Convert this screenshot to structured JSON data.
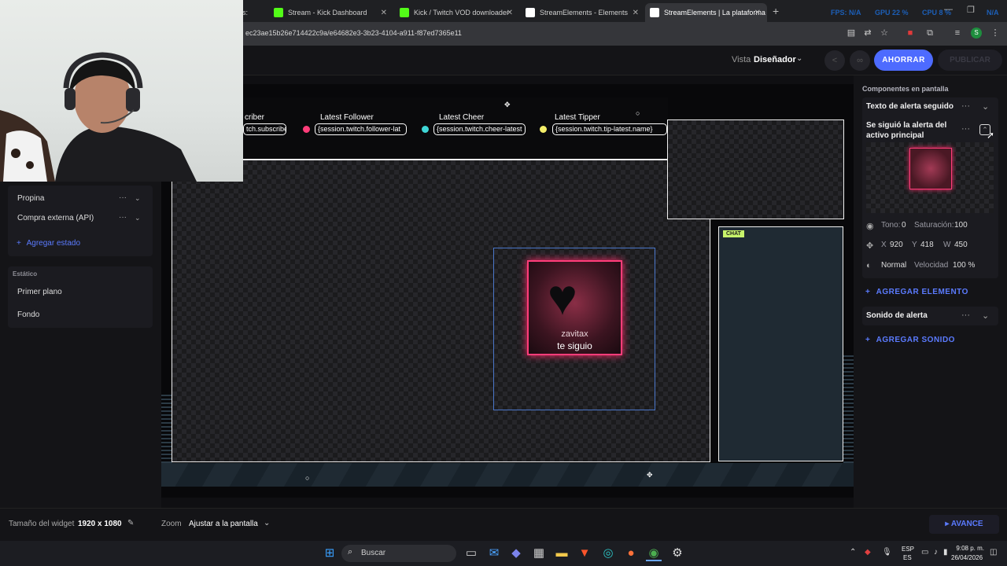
{
  "browser": {
    "tabs": [
      {
        "label": "s:",
        "fav": "#ffffff"
      },
      {
        "label": "Stream - Kick Dashboard",
        "fav": "#53fc18"
      },
      {
        "label": "Kick / Twitch VOD downloader",
        "fav": "#53fc18"
      },
      {
        "label": "StreamElements - Elements",
        "fav": "#ffffff"
      },
      {
        "label": "StreamElements | La plataforma",
        "fav": "#ffffff"
      }
    ],
    "url": "ec23ae15b26e714422c9a/e64682e3-3b23-4104-a911-f87ed7365e11",
    "perf": {
      "fps": "FPS: N/A",
      "gpu": "GPU 22 %",
      "cpu": "CPU 8 %",
      "na": "N/A"
    }
  },
  "toolbar": {
    "view_label": "Vista",
    "view_value": "Diseñador",
    "save_label": "AHORRAR",
    "publish_label": "PUBLICAR"
  },
  "left_panel": {
    "items": [
      {
        "label": "Propina"
      },
      {
        "label": "Compra externa (API)"
      }
    ],
    "add_state": "Agregar estado",
    "static_title": "Estático",
    "static_items": [
      {
        "label": "Primer plano"
      },
      {
        "label": "Fondo"
      }
    ]
  },
  "canvas": {
    "labels": [
      {
        "title": "criber",
        "value": "tch.subscriber-la"
      },
      {
        "title": "Latest Follower",
        "value": "{session.twitch.follower-lat"
      },
      {
        "title": "Latest Cheer",
        "value": "{session.twitch.cheer-latest"
      },
      {
        "title": "Latest Tipper",
        "value": "{session.twitch.tip-latest.name}"
      }
    ],
    "chat_badge": "CHAT",
    "alert_user": "zavitax",
    "alert_message": "te siguio",
    "accent": "#ff3d7a"
  },
  "right_panel": {
    "title": "Componentes en pantalla",
    "section1": "Texto de alerta seguido",
    "sub": "Se siguió la alerta del activo principal",
    "hue_label": "Tono:",
    "hue_value": "0",
    "sat_label": "Saturación:",
    "sat_value": "100",
    "x_label": "X",
    "x_value": "920",
    "y_label": "Y",
    "y_value": "418",
    "w_label": "W",
    "w_value": "450",
    "blend": "Normal",
    "speed_label": "Velocidad",
    "speed_value": "100 %",
    "add_element": "AGREGAR ELEMENTO",
    "section2": "Sonido de alerta",
    "add_sound": "AGREGAR SONIDO"
  },
  "bottom": {
    "size_label": "Tamaño del widget",
    "size_value": "1920 x 1080",
    "zoom_label": "Zoom",
    "zoom_value": "Ajustar a la pantalla",
    "advance": "AVANCE"
  },
  "taskbar": {
    "search": "Buscar",
    "lang1": "ESP",
    "lang2": "ES",
    "time": "9:08 p. m.",
    "date": "26/04/2026"
  }
}
